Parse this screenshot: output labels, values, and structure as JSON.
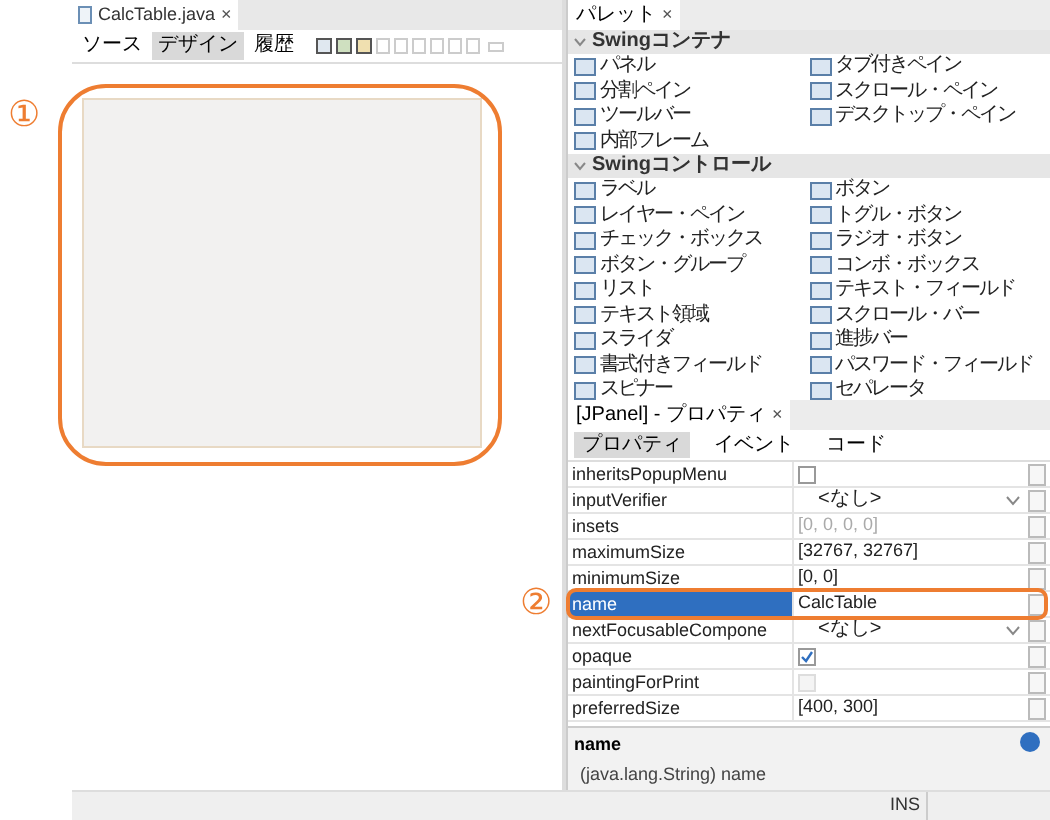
{
  "editor": {
    "file_tab": {
      "title": "CalcTable.java",
      "close": "×"
    },
    "view_tabs": [
      {
        "label": "ソース",
        "selected": false
      },
      {
        "label": "デザイン",
        "selected": true
      },
      {
        "label": "履歴",
        "selected": false
      }
    ]
  },
  "palette": {
    "title": "パレット",
    "close": "×",
    "sections": [
      {
        "title": "Swingコンテナ",
        "expanded": true,
        "items": [
          "パネル",
          "タブ付きペイン",
          "分割ペイン",
          "スクロール・ペイン",
          "ツールバー",
          "デスクトップ・ペイン",
          "内部フレーム"
        ]
      },
      {
        "title": "Swingコントロール",
        "expanded": true,
        "items": [
          "ラベル",
          "ボタン",
          "レイヤー・ペイン",
          "トグル・ボタン",
          "チェック・ボックス",
          "ラジオ・ボタン",
          "ボタン・グループ",
          "コンボ・ボックス",
          "リスト",
          "テキスト・フィールド",
          "テキスト領域",
          "スクロール・バー",
          "スライダ",
          "進捗バー",
          "書式付きフィールド",
          "パスワード・フィールド",
          "スピナー",
          "セパレータ"
        ]
      }
    ]
  },
  "properties": {
    "title": "[JPanel] - プロパティ",
    "close": "×",
    "tabs": [
      {
        "label": "プロパティ",
        "selected": true
      },
      {
        "label": "イベント",
        "selected": false
      },
      {
        "label": "コード",
        "selected": false
      }
    ],
    "rows": [
      {
        "name": "inheritsPopupMenu",
        "kind": "checkbox",
        "checked": false,
        "disabled": false,
        "selected": false
      },
      {
        "name": "inputVerifier",
        "kind": "combo",
        "value": "<なし>",
        "disabled": false,
        "selected": false
      },
      {
        "name": "insets",
        "kind": "text",
        "value": "[0, 0, 0, 0]",
        "disabled": true,
        "selected": false
      },
      {
        "name": "maximumSize",
        "kind": "text",
        "value": "[32767, 32767]",
        "disabled": false,
        "selected": false
      },
      {
        "name": "minimumSize",
        "kind": "text",
        "value": "[0, 0]",
        "disabled": false,
        "selected": false
      },
      {
        "name": "name",
        "kind": "text",
        "value": "CalcTable",
        "disabled": false,
        "selected": true
      },
      {
        "name": "nextFocusableCompone",
        "kind": "combo",
        "value": "<なし>",
        "disabled": false,
        "selected": false
      },
      {
        "name": "opaque",
        "kind": "checkbox",
        "checked": true,
        "disabled": false,
        "selected": false
      },
      {
        "name": "paintingForPrint",
        "kind": "checkbox",
        "checked": false,
        "disabled": true,
        "selected": false
      },
      {
        "name": "preferredSize",
        "kind": "text",
        "value": "[400, 300]",
        "disabled": false,
        "selected": false
      }
    ],
    "help": {
      "title": "name",
      "text": "(java.lang.String) name"
    }
  },
  "status_bar": {
    "mode": "INS"
  },
  "annotations": [
    {
      "label": "①"
    },
    {
      "label": "②"
    }
  ]
}
